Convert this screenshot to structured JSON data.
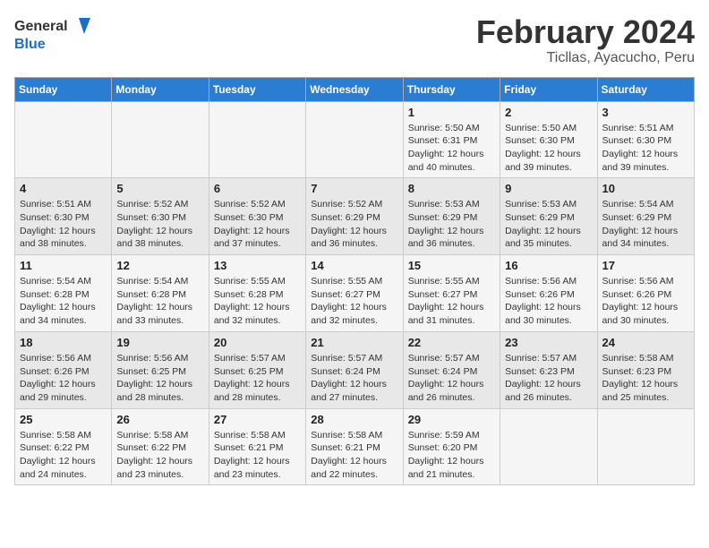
{
  "header": {
    "logo_general": "General",
    "logo_blue": "Blue",
    "month_title": "February 2024",
    "location": "Ticllas, Ayacucho, Peru"
  },
  "days_of_week": [
    "Sunday",
    "Monday",
    "Tuesday",
    "Wednesday",
    "Thursday",
    "Friday",
    "Saturday"
  ],
  "weeks": [
    {
      "days": [
        {
          "num": "",
          "info": ""
        },
        {
          "num": "",
          "info": ""
        },
        {
          "num": "",
          "info": ""
        },
        {
          "num": "",
          "info": ""
        },
        {
          "num": "1",
          "info": "Sunrise: 5:50 AM\nSunset: 6:31 PM\nDaylight: 12 hours\nand 40 minutes."
        },
        {
          "num": "2",
          "info": "Sunrise: 5:50 AM\nSunset: 6:30 PM\nDaylight: 12 hours\nand 39 minutes."
        },
        {
          "num": "3",
          "info": "Sunrise: 5:51 AM\nSunset: 6:30 PM\nDaylight: 12 hours\nand 39 minutes."
        }
      ]
    },
    {
      "days": [
        {
          "num": "4",
          "info": "Sunrise: 5:51 AM\nSunset: 6:30 PM\nDaylight: 12 hours\nand 38 minutes."
        },
        {
          "num": "5",
          "info": "Sunrise: 5:52 AM\nSunset: 6:30 PM\nDaylight: 12 hours\nand 38 minutes."
        },
        {
          "num": "6",
          "info": "Sunrise: 5:52 AM\nSunset: 6:30 PM\nDaylight: 12 hours\nand 37 minutes."
        },
        {
          "num": "7",
          "info": "Sunrise: 5:52 AM\nSunset: 6:29 PM\nDaylight: 12 hours\nand 36 minutes."
        },
        {
          "num": "8",
          "info": "Sunrise: 5:53 AM\nSunset: 6:29 PM\nDaylight: 12 hours\nand 36 minutes."
        },
        {
          "num": "9",
          "info": "Sunrise: 5:53 AM\nSunset: 6:29 PM\nDaylight: 12 hours\nand 35 minutes."
        },
        {
          "num": "10",
          "info": "Sunrise: 5:54 AM\nSunset: 6:29 PM\nDaylight: 12 hours\nand 34 minutes."
        }
      ]
    },
    {
      "days": [
        {
          "num": "11",
          "info": "Sunrise: 5:54 AM\nSunset: 6:28 PM\nDaylight: 12 hours\nand 34 minutes."
        },
        {
          "num": "12",
          "info": "Sunrise: 5:54 AM\nSunset: 6:28 PM\nDaylight: 12 hours\nand 33 minutes."
        },
        {
          "num": "13",
          "info": "Sunrise: 5:55 AM\nSunset: 6:28 PM\nDaylight: 12 hours\nand 32 minutes."
        },
        {
          "num": "14",
          "info": "Sunrise: 5:55 AM\nSunset: 6:27 PM\nDaylight: 12 hours\nand 32 minutes."
        },
        {
          "num": "15",
          "info": "Sunrise: 5:55 AM\nSunset: 6:27 PM\nDaylight: 12 hours\nand 31 minutes."
        },
        {
          "num": "16",
          "info": "Sunrise: 5:56 AM\nSunset: 6:26 PM\nDaylight: 12 hours\nand 30 minutes."
        },
        {
          "num": "17",
          "info": "Sunrise: 5:56 AM\nSunset: 6:26 PM\nDaylight: 12 hours\nand 30 minutes."
        }
      ]
    },
    {
      "days": [
        {
          "num": "18",
          "info": "Sunrise: 5:56 AM\nSunset: 6:26 PM\nDaylight: 12 hours\nand 29 minutes."
        },
        {
          "num": "19",
          "info": "Sunrise: 5:56 AM\nSunset: 6:25 PM\nDaylight: 12 hours\nand 28 minutes."
        },
        {
          "num": "20",
          "info": "Sunrise: 5:57 AM\nSunset: 6:25 PM\nDaylight: 12 hours\nand 28 minutes."
        },
        {
          "num": "21",
          "info": "Sunrise: 5:57 AM\nSunset: 6:24 PM\nDaylight: 12 hours\nand 27 minutes."
        },
        {
          "num": "22",
          "info": "Sunrise: 5:57 AM\nSunset: 6:24 PM\nDaylight: 12 hours\nand 26 minutes."
        },
        {
          "num": "23",
          "info": "Sunrise: 5:57 AM\nSunset: 6:23 PM\nDaylight: 12 hours\nand 26 minutes."
        },
        {
          "num": "24",
          "info": "Sunrise: 5:58 AM\nSunset: 6:23 PM\nDaylight: 12 hours\nand 25 minutes."
        }
      ]
    },
    {
      "days": [
        {
          "num": "25",
          "info": "Sunrise: 5:58 AM\nSunset: 6:22 PM\nDaylight: 12 hours\nand 24 minutes."
        },
        {
          "num": "26",
          "info": "Sunrise: 5:58 AM\nSunset: 6:22 PM\nDaylight: 12 hours\nand 23 minutes."
        },
        {
          "num": "27",
          "info": "Sunrise: 5:58 AM\nSunset: 6:21 PM\nDaylight: 12 hours\nand 23 minutes."
        },
        {
          "num": "28",
          "info": "Sunrise: 5:58 AM\nSunset: 6:21 PM\nDaylight: 12 hours\nand 22 minutes."
        },
        {
          "num": "29",
          "info": "Sunrise: 5:59 AM\nSunset: 6:20 PM\nDaylight: 12 hours\nand 21 minutes."
        },
        {
          "num": "",
          "info": ""
        },
        {
          "num": "",
          "info": ""
        }
      ]
    }
  ]
}
